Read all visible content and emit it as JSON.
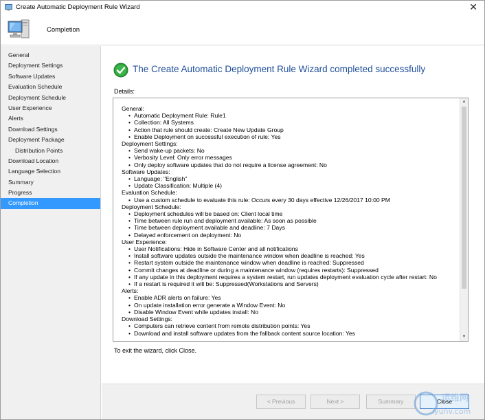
{
  "window": {
    "title": "Create Automatic Deployment Rule Wizard",
    "close_glyph": "✕"
  },
  "header": {
    "heading": "Completion"
  },
  "sidebar": {
    "items": [
      {
        "label": "General"
      },
      {
        "label": "Deployment Settings"
      },
      {
        "label": "Software Updates"
      },
      {
        "label": "Evaluation Schedule"
      },
      {
        "label": "Deployment Schedule"
      },
      {
        "label": "User Experience"
      },
      {
        "label": "Alerts"
      },
      {
        "label": "Download Settings"
      },
      {
        "label": "Deployment Package"
      },
      {
        "label": "Distribution Points"
      },
      {
        "label": "Download Location"
      },
      {
        "label": "Language Selection"
      },
      {
        "label": "Summary"
      },
      {
        "label": "Progress"
      },
      {
        "label": "Completion"
      }
    ],
    "active": "Completion"
  },
  "content": {
    "success_message": "The Create Automatic Deployment Rule Wizard completed successfully",
    "details_label": "Details:",
    "exit_text": "To exit the wizard, click Close.",
    "details": [
      {
        "section": "General:",
        "items": [
          "Automatic Deployment Rule: Rule1",
          "Collection: All Systems",
          "Action that rule should create: Create New Update Group",
          "Enable Deployment on successful execution of rule: Yes"
        ]
      },
      {
        "section": "Deployment Settings:",
        "items": [
          "Send wake-up packets: No",
          "Verbosity Level: Only error messages",
          "Only deploy software updates that do not require a license agreement: No"
        ]
      },
      {
        "section": "Software Updates:",
        "items": [
          "Language: \"English\"",
          "Update Classification: Multiple (4)"
        ]
      },
      {
        "section": "Evaluation Schedule:",
        "items": [
          "Use a custom schedule to evaluate this rule: Occurs every 30 days effective 12/26/2017 10:00 PM"
        ]
      },
      {
        "section": "Deployment Schedule:",
        "items": [
          "Deployment schedules will be based on: Client local time",
          "Time between rule run and deployment available: As soon as possible",
          "Time between deployment available and deadline: 7 Days",
          "Delayed enforcement on deployment: No"
        ]
      },
      {
        "section": "User Experience:",
        "items": [
          "User Notifications: Hide in Software Center and all notifications",
          "Install software updates outside the maintenance window when deadline is reached: Yes",
          "Restart system outside the maintenance window when deadline is reached: Suppressed",
          "Commit changes at deadline or during a maintenance window (requires restarts): Suppressed",
          "If any update in this deployment requires a system restart, run updates deployment evaluation cycle after restart: No",
          "If a restart is required it will be: Suppressed(Workstations and Servers)"
        ]
      },
      {
        "section": "Alerts:",
        "items": [
          "Enable ADR alerts on failure: Yes",
          "On update installation error generate a Window Event: No",
          "Disable Window Event while updates install: No"
        ]
      },
      {
        "section": "Download Settings:",
        "items": [
          "Computers can retrieve content from remote distribution points: Yes",
          "Download and install software updates from the fallback content source location: Yes"
        ]
      }
    ]
  },
  "footer": {
    "previous_label": "< Previous",
    "next_label": "Next >",
    "summary_label": "Summary",
    "close_label": "Close"
  },
  "watermark": {
    "cjk_text": "运维网",
    "latin_text": "iyunv.com"
  },
  "colors": {
    "accent": "#3399ff",
    "success_text": "#1e4e9a",
    "success_icon": "#2e9b3c"
  }
}
